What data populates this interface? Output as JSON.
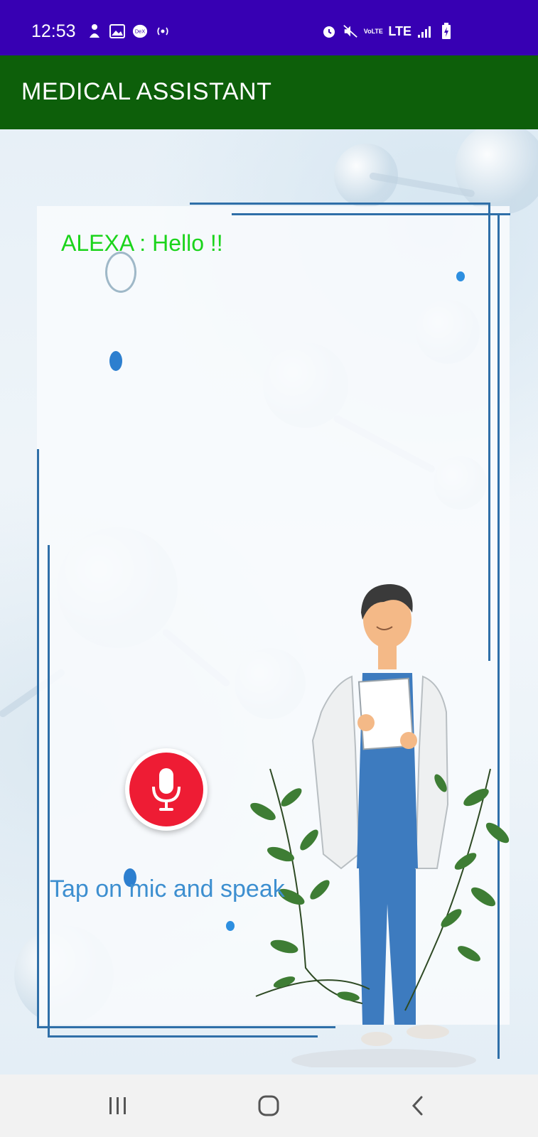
{
  "status_bar": {
    "time": "12:53",
    "left_icons": [
      "person-icon",
      "image-icon",
      "dex-icon",
      "broadcast-icon"
    ],
    "right_icons": [
      "alarm-icon",
      "mute-icon",
      "volte-icon",
      "lte-icon",
      "signal-icon",
      "battery-icon"
    ],
    "lte_label": "LTE",
    "volte_label": "VoLTE",
    "dex_label": "DeX"
  },
  "app_bar": {
    "title": "MEDICAL ASSISTANT"
  },
  "main": {
    "alexa_message": "ALEXA : Hello !!",
    "mic_icon": "microphone-icon",
    "hint": "Tap on mic and speak"
  },
  "nav_bar": {
    "buttons": [
      "recent-apps-icon",
      "home-icon",
      "back-icon"
    ]
  },
  "colors": {
    "status_bar": "#3700b3",
    "app_bar": "#0d5f0a",
    "alexa_text": "#1bd41b",
    "mic_red": "#ee1c34",
    "hint_text": "#3d8fd0"
  }
}
